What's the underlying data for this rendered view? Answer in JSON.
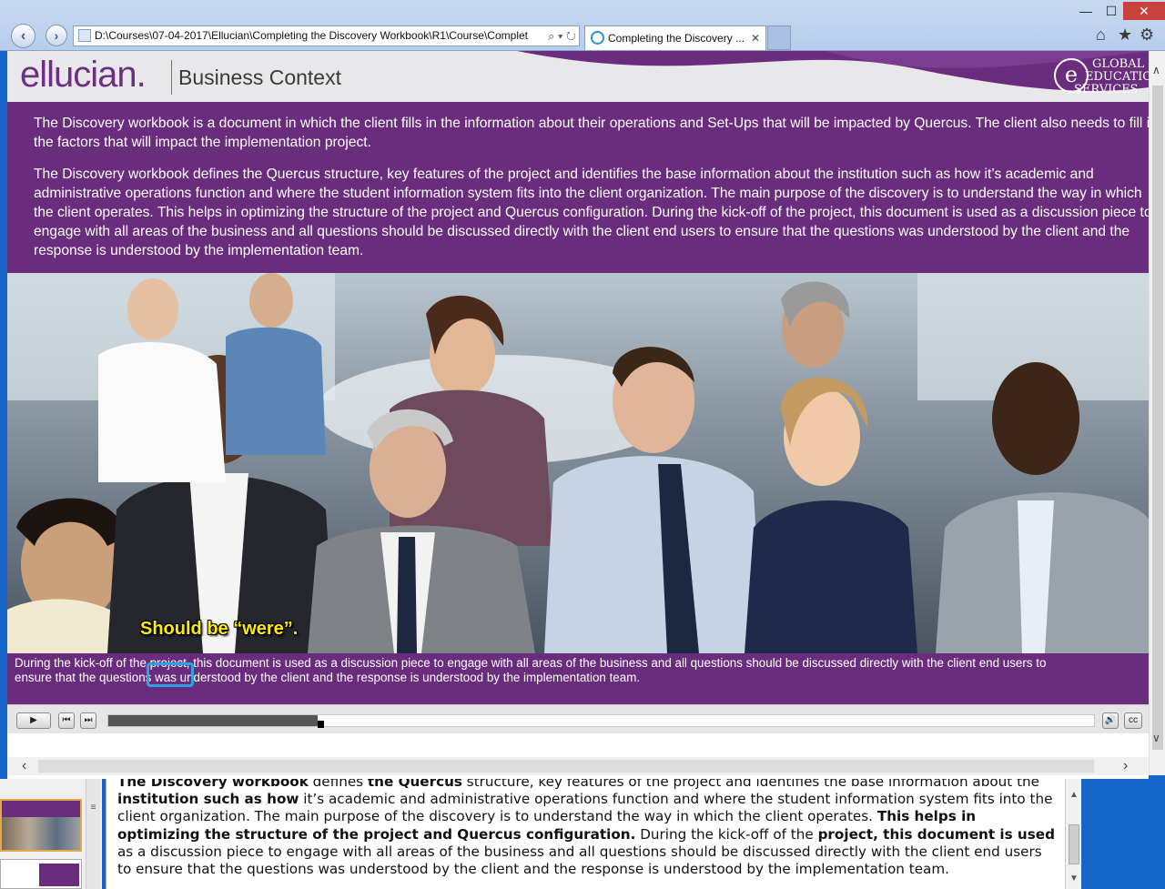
{
  "browser": {
    "address": "D:\\Courses\\07-04-2017\\Ellucian\\Completing the Discovery Workbook\\R1\\Course\\Complet",
    "tab_title": "Completing the Discovery ...",
    "back_icon": "back-arrow-icon",
    "forward_icon": "forward-arrow-icon",
    "tab_close": "✕",
    "win_min": "—",
    "win_max": "☐",
    "win_close": "✕"
  },
  "header": {
    "logo": "ellucian.",
    "title": "Business Context",
    "ges_line1": "GLOBAL",
    "ges_line2": "EDUCATION",
    "ges_line3": "SERVICES",
    "ges_mark": "e"
  },
  "content": {
    "para1": "The Discovery workbook is a document in which the client fills in the information about their operations and Set-Ups that will be impacted by Quercus. The client also needs to fill in the factors that will impact the implementation project.",
    "para2": "The Discovery workbook defines the Quercus structure, key features of the project and identifies the base information about the institution such as how it’s academic and administrative operations function and where the student information system fits into the client organization. The main purpose of the discovery is to understand the way in which the client operates. This helps in optimizing the structure of the project and Quercus configuration. During the kick-off of the project, this document is used as a discussion piece to engage with all areas of the business and all questions should be discussed directly with the client end users to ensure that the questions was understood by the client and the response is understood by the implementation team."
  },
  "caption": {
    "line1": "During the kick-off of the project, this document is used as a discussion piece to engage with all areas of the business and all questions should be discussed directly with the client end users to",
    "line2": "ensure that the questions was understood by the client and the response is understood by the implementation team."
  },
  "annotation": {
    "text": "Should be “were”."
  },
  "player": {
    "play": "▶",
    "prev": "⏮",
    "next": "⏭",
    "volume": "🔊",
    "cc": "cc",
    "progress": 0.212
  },
  "notes": {
    "html_runs": [
      {
        "t": "The Discovery workbook",
        "b": true
      },
      {
        "t": " defines ",
        "b": false
      },
      {
        "t": "the Quercus",
        "b": true
      },
      {
        "t": " structure, key features of the project and identifies the base information about the ",
        "b": false
      },
      {
        "t": "institution such as how",
        "b": true
      },
      {
        "t": " it’s academic and administrative operations function and where the student information system fits into the client organization. The main purpose of the discovery is to understand the way in which the client operates. ",
        "b": false
      },
      {
        "t": "This helps in optimizing the structure of the project and Quercus configuration.",
        "b": true
      },
      {
        "t": " During the kick-off of the ",
        "b": false
      },
      {
        "t": "project, this document is used",
        "b": true
      },
      {
        "t": " as a discussion piece to engage with all areas of the business and all questions should be discussed directly with the client end users to ensure that the questions was understood by the client and the response is understood by the implementation team.",
        "b": false
      }
    ]
  },
  "colors": {
    "brand_purple": "#6a2d7d",
    "annotation_yellow": "#ffeb00",
    "annotation_box": "#29a5e5",
    "desktop_blue": "#1565c8"
  }
}
